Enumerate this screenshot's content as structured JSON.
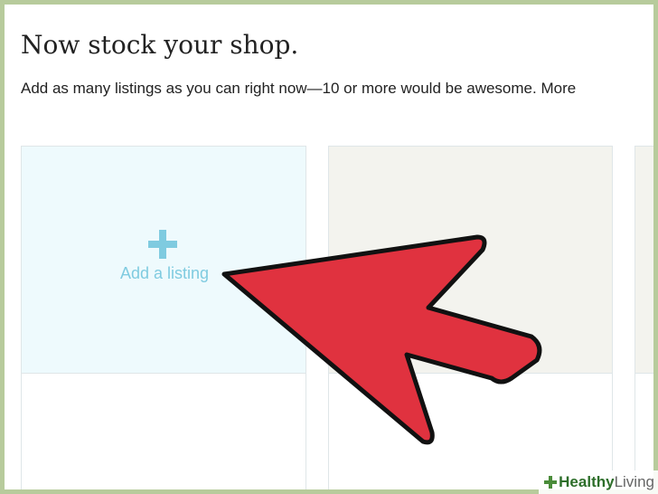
{
  "page": {
    "title": "Now stock your shop.",
    "subtitle": "Add as many listings as you can right now—10 or more would be awesome. More"
  },
  "cards": {
    "add_listing_label": "Add a listing",
    "add_icon": "plus-icon"
  },
  "annotation": {
    "arrow_color": "#e0323f",
    "arrow_icon": "pointer-arrow-icon"
  },
  "watermark": {
    "brand_bold": "Healthy",
    "brand_light": "Living"
  }
}
